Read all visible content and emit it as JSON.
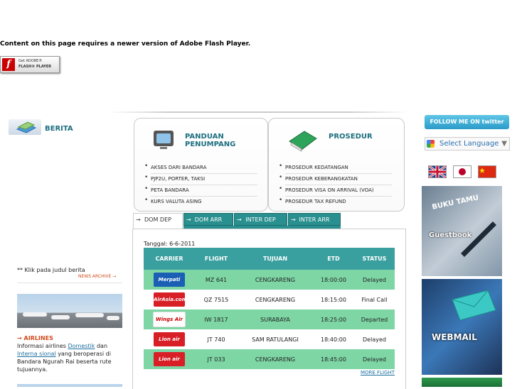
{
  "flash": {
    "message": "Content on this page requires a newer version of Adobe Flash Player.",
    "button_line1": "Get ADOBE®",
    "button_line2": "FLASH® PLAYER"
  },
  "berita": {
    "label": "BERITA"
  },
  "panduan": {
    "title": "PANDUAN PENUMPANG",
    "items": [
      "AKSES DARI BANDARA",
      "PJP2U, PORTER, TAKSI",
      "PETA BANDARA",
      "KURS VALUTA ASING"
    ]
  },
  "prosedur": {
    "title": "PROSEDUR",
    "items": [
      "PROSEDUR KEDATANGAN",
      "PROSEDUR KEBERANGKATAN",
      "PROSEDUR VISA ON ARRIVAL (VOA)",
      "PROSEDUR TAX REFUND"
    ]
  },
  "tabs": [
    "DOM DEP",
    "DOM ARR",
    "INTER DEP",
    "INTER ARR"
  ],
  "flights": {
    "date_label": "Tanggal:",
    "date_value": "6-6-2011",
    "headers": [
      "CARRIER",
      "FLIGHT",
      "TUJUAN",
      "ETD",
      "STATUS"
    ],
    "rows": [
      {
        "carrier": "Merpati",
        "flight": "MZ 641",
        "tujuan": "CENGKARENG",
        "etd": "18:00:00",
        "status": "Delayed"
      },
      {
        "carrier": "AirAsia.com",
        "flight": "QZ 7515",
        "tujuan": "CENGKARENG",
        "etd": "18:15:00",
        "status": "Final Call"
      },
      {
        "carrier": "Wings Air",
        "flight": "IW 1817",
        "tujuan": "SURABAYA",
        "etd": "18:25:00",
        "status": "Departed"
      },
      {
        "carrier": "Lion air",
        "flight": "JT 740",
        "tujuan": "SAM RATULANGI",
        "etd": "18:40:00",
        "status": "Delayed"
      },
      {
        "carrier": "Lion air",
        "flight": "JT 033",
        "tujuan": "CENGKARENG",
        "etd": "18:45:00",
        "status": "Delayed"
      }
    ],
    "more": "MORE FLIGHT"
  },
  "left": {
    "note": "** Klik pada judul berita",
    "news_archive": "NEWS ARCHIVE",
    "airlines_title": "AIRLINES",
    "airlines_text_1": "Informasi airlines",
    "link_domestik": "Domestik",
    "airlines_text_2": "dan",
    "link_internasional": "Interna sional",
    "airlines_text_3": "yang beroperasi di Bandara Ngurah Rai beserta rute tujuannya."
  },
  "right": {
    "twitter": "FOLLOW ME ON twitter",
    "language": "Select Language",
    "buku_tamu": "BUKU TAMU",
    "guestbook": "Guestbook",
    "webmail": "WEBMAIL"
  },
  "colors": {
    "teal": "#2a8f8f",
    "row_green": "#7ed6a5",
    "accent_orange": "#d04a1a"
  }
}
